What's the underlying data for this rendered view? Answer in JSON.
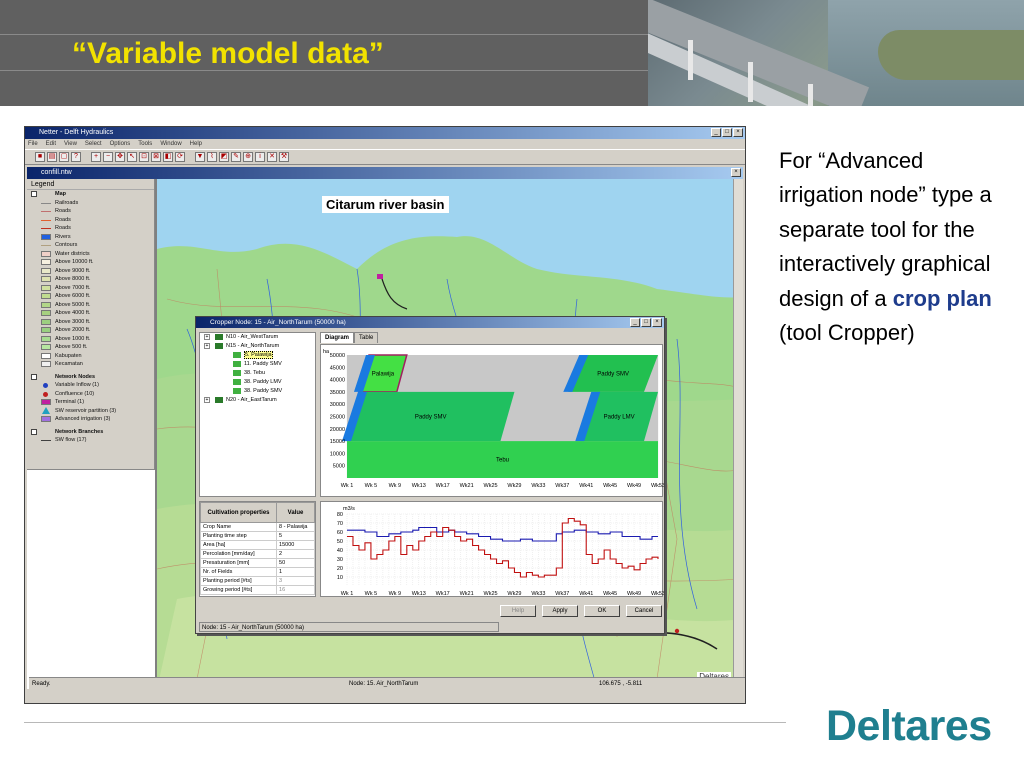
{
  "slide": {
    "title": "“Variable model data”",
    "description_parts": [
      "For “Advanced irrigation node” type a separate tool for the interactively graphical design of a ",
      "crop plan",
      " (tool Cropper)"
    ],
    "logo": "Deltares"
  },
  "app": {
    "title": "Netter - Delft Hydraulics",
    "menu": [
      "File",
      "Edit",
      "View",
      "Select",
      "Options",
      "Tools",
      "Window",
      "Help"
    ],
    "child_title": "confill.ntw",
    "legend_title": "Legend",
    "legend_items": [
      {
        "label": "Map",
        "kind": "header"
      },
      {
        "label": "Railroads",
        "color": "#888888",
        "kind": "line"
      },
      {
        "label": "Roads",
        "color": "#c07070",
        "kind": "line"
      },
      {
        "label": "Roads",
        "color": "#e06030",
        "kind": "line"
      },
      {
        "label": "Roads",
        "color": "#c03020",
        "kind": "line"
      },
      {
        "label": "Rivers",
        "color": "#2060e0",
        "kind": "fill"
      },
      {
        "label": "Contours",
        "color": "#b0a080",
        "kind": "line"
      },
      {
        "label": "Water districts",
        "color": "#f0d0c8",
        "kind": "fill"
      },
      {
        "label": "Above 10000 ft.",
        "color": "#f6f0e0",
        "kind": "fill"
      },
      {
        "label": "Above 9000 ft.",
        "color": "#e8e8c8",
        "kind": "fill"
      },
      {
        "label": "Above 8000 ft.",
        "color": "#dde2b0",
        "kind": "fill"
      },
      {
        "label": "Above 7000 ft.",
        "color": "#cfe0a0",
        "kind": "fill"
      },
      {
        "label": "Above 6000 ft.",
        "color": "#c0dc90",
        "kind": "fill"
      },
      {
        "label": "Above 5000 ft.",
        "color": "#b2d688",
        "kind": "fill"
      },
      {
        "label": "Above 4000 ft.",
        "color": "#a6d080",
        "kind": "fill"
      },
      {
        "label": "Above 3000 ft.",
        "color": "#9cd080",
        "kind": "fill"
      },
      {
        "label": "Above 2000 ft.",
        "color": "#98d080",
        "kind": "fill"
      },
      {
        "label": "Above 1000 ft.",
        "color": "#a6dc90",
        "kind": "fill"
      },
      {
        "label": "Above 500 ft.",
        "color": "#b6e6a0",
        "kind": "fill"
      },
      {
        "label": "Kabupaten",
        "color": "#ffffff",
        "kind": "fill"
      },
      {
        "label": "Kecamatan",
        "color": "#f0f0f0",
        "kind": "fill"
      },
      {
        "label": "",
        "kind": "gap"
      },
      {
        "label": "Network Nodes",
        "kind": "header"
      },
      {
        "label": "Variable Inflow (1)",
        "color": "#2040c0",
        "kind": "dot"
      },
      {
        "label": "Confluence (10)",
        "color": "#c02020",
        "kind": "dot"
      },
      {
        "label": "Terminal (1)",
        "color": "#c020a0",
        "kind": "fill"
      },
      {
        "label": "SW reservoir partition (3)",
        "color": "#20a0c0",
        "kind": "tri"
      },
      {
        "label": "Advanced irrigation (3)",
        "color": "#a070e0",
        "kind": "fill"
      },
      {
        "label": "",
        "kind": "gap"
      },
      {
        "label": "Network Branches",
        "kind": "header"
      },
      {
        "label": "SW flow (17)",
        "color": "#404040",
        "kind": "line"
      }
    ],
    "map_title": "Citarum river basin",
    "map_watermark": "Deltares",
    "status": {
      "left": "Ready.",
      "middle": "Node: 15. Air_NorthTarum",
      "right": "106.675 , -5.811"
    }
  },
  "cropper": {
    "title": "Cropper Node: 15 - Air_NorthTarum (50000 ha)",
    "tree": [
      {
        "label": "N10 - Air_WestTarum",
        "level": 0
      },
      {
        "label": "N15 - Air_NorthTarum",
        "level": 0
      },
      {
        "label": "5. Palawija",
        "level": 1,
        "selected": true
      },
      {
        "label": "11. Paddy SMV",
        "level": 1
      },
      {
        "label": "38. Tebu",
        "level": 1
      },
      {
        "label": "38. Paddy LMV",
        "level": 1
      },
      {
        "label": "38. Paddy SMV",
        "level": 1
      },
      {
        "label": "N20 - Air_EastTarum",
        "level": 0
      }
    ],
    "tabs": [
      "Diagram",
      "Table"
    ],
    "props_header": [
      "Cultivation properties",
      "Value"
    ],
    "props": [
      [
        "Crop Name",
        "8 - Palawija"
      ],
      [
        "Planting time step",
        "5"
      ],
      [
        "Area [ha]",
        "15000"
      ],
      [
        "Percolation [mm/day]",
        "2"
      ],
      [
        "Presaturation [mm]",
        "50"
      ],
      [
        "Nr. of Fields",
        "1"
      ],
      [
        "Planting period [#ts]",
        "3"
      ],
      [
        "Growing period [#ts]",
        "16"
      ]
    ],
    "buttons": [
      {
        "label": "Help",
        "enabled": false
      },
      {
        "label": "Apply",
        "enabled": true
      },
      {
        "label": "OK",
        "enabled": true
      },
      {
        "label": "Cancel",
        "enabled": true
      }
    ],
    "node_status": "Node: 15 - Air_NorthTarum (50000 ha)"
  },
  "chart_data": [
    {
      "type": "area",
      "title": "Diagram",
      "ylabel": "ha",
      "ylim": [
        0,
        50000
      ],
      "y_ticks": [
        5000,
        10000,
        15000,
        20000,
        25000,
        30000,
        35000,
        40000,
        45000,
        50000
      ],
      "x_tick_labels": [
        "Wk 1",
        "Wk 5",
        "Wk 9",
        "Wk13",
        "Wk17",
        "Wk21",
        "Wk25",
        "Wk29",
        "Wk33",
        "Wk37",
        "Wk41",
        "Wk45",
        "Wk49",
        "Wk53"
      ],
      "crop_blocks": [
        {
          "name": "Palawija",
          "y_range": [
            35000,
            50000
          ],
          "week_range": [
            3,
            11
          ]
        },
        {
          "name": "Paddy SMV",
          "y_range": [
            35000,
            50000
          ],
          "week_range": [
            38,
            53
          ]
        },
        {
          "name": "Paddy SMV",
          "y_range": [
            15000,
            35000
          ],
          "week_range": [
            1,
            29
          ]
        },
        {
          "name": "Paddy LMV",
          "y_range": [
            15000,
            35000
          ],
          "week_range": [
            40,
            53
          ]
        },
        {
          "name": "Tebu",
          "y_range": [
            0,
            15000
          ],
          "week_range": [
            1,
            53
          ]
        }
      ]
    },
    {
      "type": "line",
      "ylabel": "m3/s",
      "ylim": [
        0,
        80
      ],
      "y_ticks": [
        10,
        20,
        30,
        40,
        50,
        60,
        70,
        80
      ],
      "x_tick_labels": [
        "Wk 1",
        "Wk 5",
        "Wk 9",
        "Wk13",
        "Wk17",
        "Wk21",
        "Wk25",
        "Wk29",
        "Wk33",
        "Wk37",
        "Wk41",
        "Wk45",
        "Wk49",
        "Wk53"
      ],
      "x": [
        1,
        2,
        3,
        4,
        5,
        6,
        7,
        8,
        9,
        10,
        11,
        12,
        13,
        14,
        15,
        16,
        17,
        18,
        19,
        20,
        21,
        22,
        23,
        24,
        25,
        26,
        27,
        28,
        29,
        30,
        31,
        32,
        33,
        34,
        35,
        36,
        37,
        38,
        39,
        40,
        41,
        42,
        43,
        44,
        45,
        46,
        47,
        48,
        49,
        50,
        51,
        52,
        53
      ],
      "series": [
        {
          "color": "#1a1ab0",
          "values": [
            62,
            62,
            62,
            60,
            60,
            55,
            55,
            58,
            58,
            60,
            60,
            62,
            65,
            65,
            65,
            60,
            60,
            62,
            60,
            60,
            58,
            58,
            55,
            55,
            52,
            52,
            50,
            50,
            50,
            52,
            52,
            50,
            50,
            50,
            50,
            58,
            60,
            60,
            62,
            62,
            60,
            60,
            58,
            58,
            60,
            60,
            55,
            55,
            55,
            52,
            52,
            55,
            55
          ]
        },
        {
          "color": "#c01010",
          "values": [
            55,
            45,
            40,
            48,
            30,
            35,
            40,
            50,
            55,
            35,
            45,
            40,
            50,
            55,
            60,
            55,
            65,
            62,
            55,
            50,
            52,
            45,
            40,
            35,
            30,
            25,
            28,
            20,
            15,
            10,
            15,
            12,
            10,
            12,
            12,
            20,
            70,
            75,
            72,
            68,
            35,
            25,
            30,
            40,
            30,
            25,
            20,
            22,
            18,
            25,
            30,
            32,
            30
          ]
        }
      ]
    }
  ]
}
